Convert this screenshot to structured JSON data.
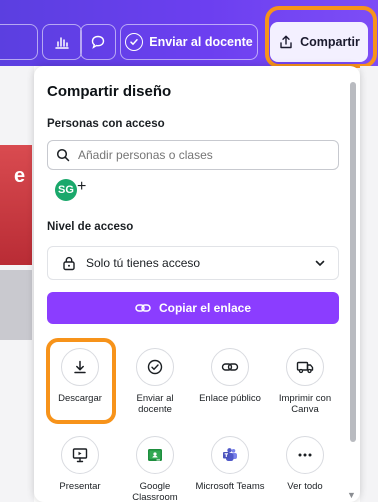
{
  "toolbar": {
    "send_label": "Enviar al docente",
    "share_label": "Compartir"
  },
  "panel": {
    "title": "Compartir diseño",
    "people_label": "Personas con acceso",
    "search_placeholder": "Añadir personas o clases",
    "avatar_initials": "SG",
    "avatar_add": "+",
    "access_label": "Nivel de acceso",
    "access_value": "Solo tú tienes acceso",
    "copy_link_label": "Copiar el enlace"
  },
  "options": [
    {
      "label": "Descargar",
      "icon": "download-icon"
    },
    {
      "label": "Enviar al docente",
      "icon": "check-circle-icon"
    },
    {
      "label": "Enlace público",
      "icon": "link-icon"
    },
    {
      "label": "Imprimir con Canva",
      "icon": "truck-icon"
    },
    {
      "label": "Presentar",
      "icon": "present-icon"
    },
    {
      "label": "Google Classroom",
      "icon": "google-classroom-icon"
    },
    {
      "label": "Microsoft Teams",
      "icon": "microsoft-teams-icon"
    },
    {
      "label": "Ver todo",
      "icon": "more-icon"
    }
  ],
  "background": {
    "partial_text": "e"
  },
  "colors": {
    "accent": "#8b3dff",
    "toolbar": "#6c3ff0",
    "highlight": "#f7931a"
  }
}
